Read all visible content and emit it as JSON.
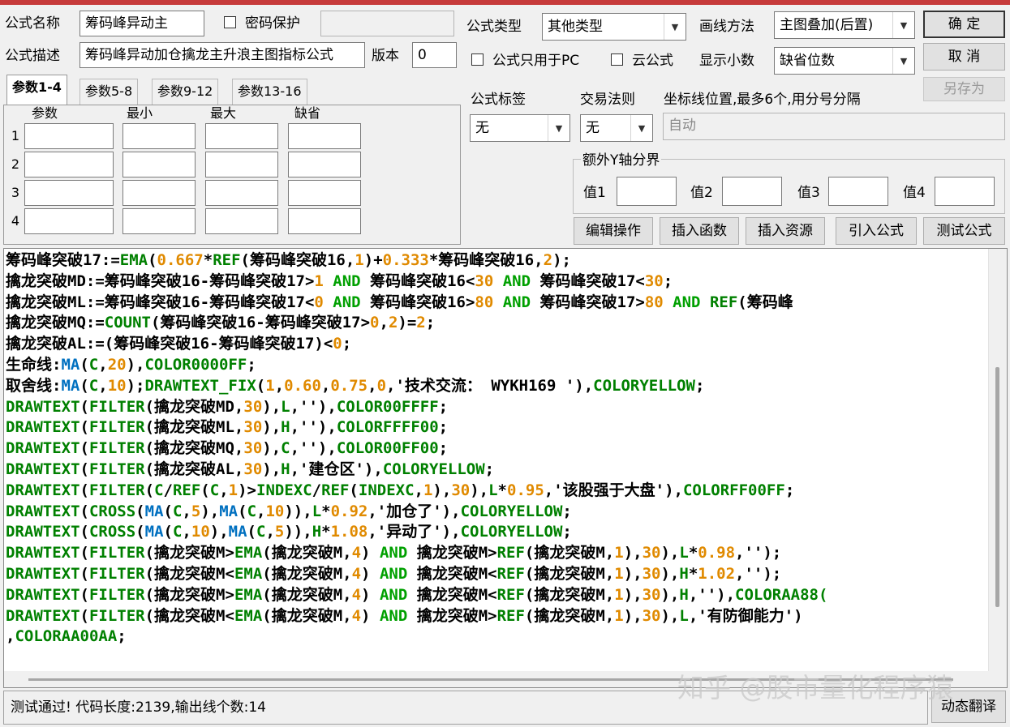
{
  "colors": {
    "accent_bar": "#c63a3a",
    "code_default": "#000000",
    "code_func_green": "#008000",
    "code_func_blue": "#0070c0",
    "code_number_orange": "#e08a00",
    "code_keyword_green": "#00a000"
  },
  "form": {
    "name_label": "公式名称",
    "name_value": "筹码峰异动主",
    "password_label": "密码保护",
    "password_checked": false,
    "desc_label": "公式描述",
    "desc_value": "筹码峰异动加仓擒龙主升浪主图指标公式",
    "version_label": "版本",
    "version_value": "0",
    "type_label": "公式类型",
    "type_value": "其他类型",
    "draw_label": "画线方法",
    "draw_value": "主图叠加(后置)",
    "pc_only_label": "公式只用于PC",
    "pc_only_checked": false,
    "cloud_label": "云公式",
    "cloud_checked": false,
    "decimals_label": "显示小数",
    "decimals_value": "缺省位数",
    "tag_label": "公式标签",
    "tag_value": "无",
    "rule_label": "交易法则",
    "rule_value": "无",
    "coord_label": "坐标线位置,最多6个,用分号分隔",
    "coord_value": "自动",
    "y_axis_group": "额外Y轴分界",
    "y_values": [
      "值1",
      "值2",
      "值3",
      "值4"
    ]
  },
  "buttons": {
    "ok": "确  定",
    "cancel": "取  消",
    "save_as": "另存为",
    "edit_ops": "编辑操作",
    "insert_func": "插入函数",
    "insert_res": "插入资源",
    "import_formula": "引入公式",
    "test_formula": "测试公式",
    "dyn_translate": "动态翻译"
  },
  "tabs": [
    "参数1-4",
    "参数5-8",
    "参数9-12",
    "参数13-16"
  ],
  "param_headers": [
    "参数",
    "最小",
    "最大",
    "缺省"
  ],
  "param_rows": [
    "1",
    "2",
    "3",
    "4"
  ],
  "code_lines": [
    [
      [
        "筹码峰突破17:=",
        "d"
      ],
      [
        "EMA",
        "g"
      ],
      [
        "(",
        "d"
      ],
      [
        "0.667",
        "o"
      ],
      [
        "*",
        "d"
      ],
      [
        "REF",
        "g"
      ],
      [
        "(筹码峰突破16,",
        "d"
      ],
      [
        "1",
        "o"
      ],
      [
        ")+",
        "d"
      ],
      [
        "0.333",
        "o"
      ],
      [
        "*筹码峰突破16,",
        "d"
      ],
      [
        "2",
        "o"
      ],
      [
        ");",
        "d"
      ]
    ],
    [
      [
        "擒龙突破MD:=筹码峰突破16-筹码峰突破17>",
        "d"
      ],
      [
        "1",
        "o"
      ],
      [
        " ",
        "d"
      ],
      [
        "AND",
        "k"
      ],
      [
        " 筹码峰突破16<",
        "d"
      ],
      [
        "30",
        "o"
      ],
      [
        " ",
        "d"
      ],
      [
        "AND",
        "k"
      ],
      [
        " 筹码峰突破17<",
        "d"
      ],
      [
        "30",
        "o"
      ],
      [
        ";",
        "d"
      ]
    ],
    [
      [
        "擒龙突破ML:=筹码峰突破16-筹码峰突破17<",
        "d"
      ],
      [
        "0",
        "o"
      ],
      [
        " ",
        "d"
      ],
      [
        "AND",
        "k"
      ],
      [
        " 筹码峰突破16>",
        "d"
      ],
      [
        "80",
        "o"
      ],
      [
        " ",
        "d"
      ],
      [
        "AND",
        "k"
      ],
      [
        " 筹码峰突破17>",
        "d"
      ],
      [
        "80",
        "o"
      ],
      [
        " ",
        "d"
      ],
      [
        "AND",
        "k"
      ],
      [
        " ",
        "d"
      ],
      [
        "REF",
        "g"
      ],
      [
        "(筹码峰",
        "d"
      ]
    ],
    [
      [
        "擒龙突破MQ:=",
        "d"
      ],
      [
        "COUNT",
        "g"
      ],
      [
        "(筹码峰突破16-筹码峰突破17>",
        "d"
      ],
      [
        "0",
        "o"
      ],
      [
        ",",
        "d"
      ],
      [
        "2",
        "o"
      ],
      [
        ")=",
        "d"
      ],
      [
        "2",
        "o"
      ],
      [
        ";",
        "d"
      ]
    ],
    [
      [
        "擒龙突破AL:=(筹码峰突破16-筹码峰突破17)<",
        "d"
      ],
      [
        "0",
        "o"
      ],
      [
        ";",
        "d"
      ]
    ],
    [
      [
        "生命线:",
        "d"
      ],
      [
        "MA",
        "b"
      ],
      [
        "(",
        "d"
      ],
      [
        "C",
        "g"
      ],
      [
        ",",
        "d"
      ],
      [
        "20",
        "o"
      ],
      [
        "),",
        "d"
      ],
      [
        "COLOR0000FF",
        "g"
      ],
      [
        ";",
        "d"
      ]
    ],
    [
      [
        "取舍线:",
        "d"
      ],
      [
        "MA",
        "b"
      ],
      [
        "(",
        "d"
      ],
      [
        "C",
        "g"
      ],
      [
        ",",
        "d"
      ],
      [
        "10",
        "o"
      ],
      [
        ");",
        "d"
      ],
      [
        "DRAWTEXT_FIX",
        "g"
      ],
      [
        "(",
        "d"
      ],
      [
        "1",
        "o"
      ],
      [
        ",",
        "d"
      ],
      [
        "0.60",
        "o"
      ],
      [
        ",",
        "d"
      ],
      [
        "0.75",
        "o"
      ],
      [
        ",",
        "d"
      ],
      [
        "0",
        "o"
      ],
      [
        ",'技术交流： WYKH169 '),",
        "d"
      ],
      [
        "COLORYELLOW",
        "g"
      ],
      [
        ";",
        "d"
      ]
    ],
    [
      [
        "DRAWTEXT",
        "g"
      ],
      [
        "(",
        "d"
      ],
      [
        "FILTER",
        "g"
      ],
      [
        "(擒龙突破MD,",
        "d"
      ],
      [
        "30",
        "o"
      ],
      [
        "),",
        "d"
      ],
      [
        "L",
        "g"
      ],
      [
        ",''),",
        "d"
      ],
      [
        "COLOR00FFFF",
        "g"
      ],
      [
        ";",
        "d"
      ]
    ],
    [
      [
        "DRAWTEXT",
        "g"
      ],
      [
        "(",
        "d"
      ],
      [
        "FILTER",
        "g"
      ],
      [
        "(擒龙突破ML,",
        "d"
      ],
      [
        "30",
        "o"
      ],
      [
        "),",
        "d"
      ],
      [
        "H",
        "g"
      ],
      [
        ",''),",
        "d"
      ],
      [
        "COLORFFFF00",
        "g"
      ],
      [
        ";",
        "d"
      ]
    ],
    [
      [
        "DRAWTEXT",
        "g"
      ],
      [
        "(",
        "d"
      ],
      [
        "FILTER",
        "g"
      ],
      [
        "(擒龙突破MQ,",
        "d"
      ],
      [
        "30",
        "o"
      ],
      [
        "),",
        "d"
      ],
      [
        "C",
        "g"
      ],
      [
        ",''),",
        "d"
      ],
      [
        "COLOR00FF00",
        "g"
      ],
      [
        ";",
        "d"
      ]
    ],
    [
      [
        "DRAWTEXT",
        "g"
      ],
      [
        "(",
        "d"
      ],
      [
        "FILTER",
        "g"
      ],
      [
        "(擒龙突破AL,",
        "d"
      ],
      [
        "30",
        "o"
      ],
      [
        "),",
        "d"
      ],
      [
        "H",
        "g"
      ],
      [
        ",'建仓区'),",
        "d"
      ],
      [
        "COLORYELLOW",
        "g"
      ],
      [
        ";",
        "d"
      ]
    ],
    [
      [
        "DRAWTEXT",
        "g"
      ],
      [
        "(",
        "d"
      ],
      [
        "FILTER",
        "g"
      ],
      [
        "(",
        "d"
      ],
      [
        "C",
        "g"
      ],
      [
        "/",
        "d"
      ],
      [
        "REF",
        "g"
      ],
      [
        "(",
        "d"
      ],
      [
        "C",
        "g"
      ],
      [
        ",",
        "d"
      ],
      [
        "1",
        "o"
      ],
      [
        ")>",
        "d"
      ],
      [
        "INDEXC",
        "g"
      ],
      [
        "/",
        "d"
      ],
      [
        "REF",
        "g"
      ],
      [
        "(",
        "d"
      ],
      [
        "INDEXC",
        "g"
      ],
      [
        ",",
        "d"
      ],
      [
        "1",
        "o"
      ],
      [
        "),",
        "d"
      ],
      [
        "30",
        "o"
      ],
      [
        "),",
        "d"
      ],
      [
        "L",
        "g"
      ],
      [
        "*",
        "d"
      ],
      [
        "0.95",
        "o"
      ],
      [
        ",'该股强于大盘'),",
        "d"
      ],
      [
        "COLORFF00FF",
        "g"
      ],
      [
        ";",
        "d"
      ]
    ],
    [
      [
        "DRAWTEXT",
        "g"
      ],
      [
        "(",
        "d"
      ],
      [
        "CROSS",
        "g"
      ],
      [
        "(",
        "d"
      ],
      [
        "MA",
        "b"
      ],
      [
        "(",
        "d"
      ],
      [
        "C",
        "g"
      ],
      [
        ",",
        "d"
      ],
      [
        "5",
        "o"
      ],
      [
        "),",
        "d"
      ],
      [
        "MA",
        "b"
      ],
      [
        "(",
        "d"
      ],
      [
        "C",
        "g"
      ],
      [
        ",",
        "d"
      ],
      [
        "10",
        "o"
      ],
      [
        ")),",
        "d"
      ],
      [
        "L",
        "g"
      ],
      [
        "*",
        "d"
      ],
      [
        "0.92",
        "o"
      ],
      [
        ",'加仓了'),",
        "d"
      ],
      [
        "COLORYELLOW",
        "g"
      ],
      [
        ";",
        "d"
      ]
    ],
    [
      [
        "DRAWTEXT",
        "g"
      ],
      [
        "(",
        "d"
      ],
      [
        "CROSS",
        "g"
      ],
      [
        "(",
        "d"
      ],
      [
        "MA",
        "b"
      ],
      [
        "(",
        "d"
      ],
      [
        "C",
        "g"
      ],
      [
        ",",
        "d"
      ],
      [
        "10",
        "o"
      ],
      [
        "),",
        "d"
      ],
      [
        "MA",
        "b"
      ],
      [
        "(",
        "d"
      ],
      [
        "C",
        "g"
      ],
      [
        ",",
        "d"
      ],
      [
        "5",
        "o"
      ],
      [
        ")),",
        "d"
      ],
      [
        "H",
        "g"
      ],
      [
        "*",
        "d"
      ],
      [
        "1.08",
        "o"
      ],
      [
        ",'异动了'),",
        "d"
      ],
      [
        "COLORYELLOW",
        "g"
      ],
      [
        ";",
        "d"
      ]
    ],
    [
      [
        "DRAWTEXT",
        "g"
      ],
      [
        "(",
        "d"
      ],
      [
        "FILTER",
        "g"
      ],
      [
        "(擒龙突破M>",
        "d"
      ],
      [
        "EMA",
        "g"
      ],
      [
        "(擒龙突破M,",
        "d"
      ],
      [
        "4",
        "o"
      ],
      [
        ") ",
        "d"
      ],
      [
        "AND",
        "k"
      ],
      [
        " 擒龙突破M>",
        "d"
      ],
      [
        "REF",
        "g"
      ],
      [
        "(擒龙突破M,",
        "d"
      ],
      [
        "1",
        "o"
      ],
      [
        "),",
        "d"
      ],
      [
        "30",
        "o"
      ],
      [
        "),",
        "d"
      ],
      [
        "L",
        "g"
      ],
      [
        "*",
        "d"
      ],
      [
        "0.98",
        "o"
      ],
      [
        ",'');",
        "d"
      ]
    ],
    [
      [
        "DRAWTEXT",
        "g"
      ],
      [
        "(",
        "d"
      ],
      [
        "FILTER",
        "g"
      ],
      [
        "(擒龙突破M<",
        "d"
      ],
      [
        "EMA",
        "g"
      ],
      [
        "(擒龙突破M,",
        "d"
      ],
      [
        "4",
        "o"
      ],
      [
        ") ",
        "d"
      ],
      [
        "AND",
        "k"
      ],
      [
        " 擒龙突破M<",
        "d"
      ],
      [
        "REF",
        "g"
      ],
      [
        "(擒龙突破M,",
        "d"
      ],
      [
        "1",
        "o"
      ],
      [
        "),",
        "d"
      ],
      [
        "30",
        "o"
      ],
      [
        "),",
        "d"
      ],
      [
        "H",
        "g"
      ],
      [
        "*",
        "d"
      ],
      [
        "1.02",
        "o"
      ],
      [
        ",'');",
        "d"
      ]
    ],
    [
      [
        "DRAWTEXT",
        "g"
      ],
      [
        "(",
        "d"
      ],
      [
        "FILTER",
        "g"
      ],
      [
        "(擒龙突破M>",
        "d"
      ],
      [
        "EMA",
        "g"
      ],
      [
        "(擒龙突破M,",
        "d"
      ],
      [
        "4",
        "o"
      ],
      [
        ") ",
        "d"
      ],
      [
        "AND",
        "k"
      ],
      [
        " 擒龙突破M<",
        "d"
      ],
      [
        "REF",
        "g"
      ],
      [
        "(擒龙突破M,",
        "d"
      ],
      [
        "1",
        "o"
      ],
      [
        "),",
        "d"
      ],
      [
        "30",
        "o"
      ],
      [
        "),",
        "d"
      ],
      [
        "H",
        "g"
      ],
      [
        ",''),",
        "d"
      ],
      [
        "COLORAA88(",
        "g"
      ]
    ],
    [
      [
        "DRAWTEXT",
        "g"
      ],
      [
        "(",
        "d"
      ],
      [
        "FILTER",
        "g"
      ],
      [
        "(擒龙突破M<",
        "d"
      ],
      [
        "EMA",
        "g"
      ],
      [
        "(擒龙突破M,",
        "d"
      ],
      [
        "4",
        "o"
      ],
      [
        ") ",
        "d"
      ],
      [
        "AND",
        "k"
      ],
      [
        " 擒龙突破M>",
        "d"
      ],
      [
        "REF",
        "g"
      ],
      [
        "(擒龙突破M,",
        "d"
      ],
      [
        "1",
        "o"
      ],
      [
        "),",
        "d"
      ],
      [
        "30",
        "o"
      ],
      [
        "),",
        "d"
      ],
      [
        "L",
        "g"
      ],
      [
        ",'有防御能力')",
        "d"
      ]
    ],
    [
      [
        ",",
        "d"
      ],
      [
        "COLORAA00AA",
        "g"
      ],
      [
        ";",
        "d"
      ]
    ]
  ],
  "status": "测试通过! 代码长度:2139,输出线个数:14",
  "watermark": "知乎 @股市量化程序猿"
}
